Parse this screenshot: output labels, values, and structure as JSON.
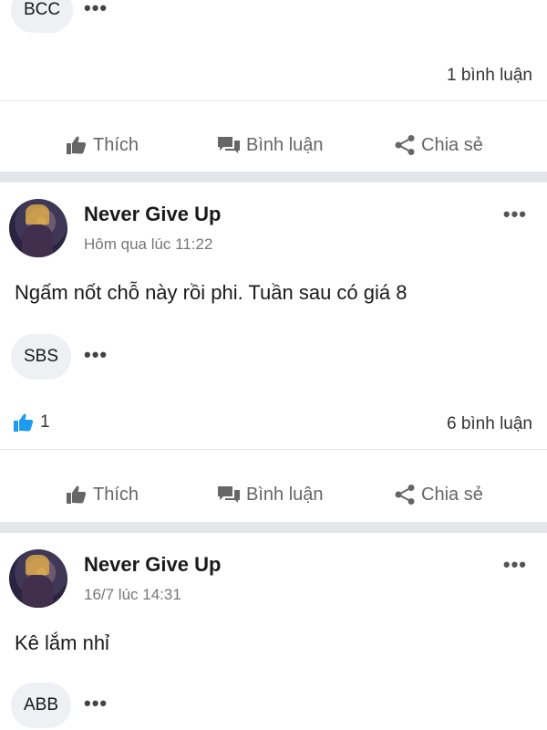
{
  "posts": [
    {
      "tag": "BCC",
      "likes": "",
      "comments": "1 bình luận",
      "actions": {
        "like": "Thích",
        "comment": "Bình luận",
        "share": "Chia sẻ"
      }
    },
    {
      "author": "Never Give Up",
      "time": "Hôm qua lúc 11:22",
      "text": "Ngấm nốt chỗ này rồi phi. Tuần sau có giá 8",
      "tag": "SBS",
      "likes": "1",
      "comments": "6 bình luận",
      "actions": {
        "like": "Thích",
        "comment": "Bình luận",
        "share": "Chia sẻ"
      }
    },
    {
      "author": "Never Give Up",
      "time": "16/7 lúc 14:31",
      "text": "Kê lắm nhỉ",
      "tag": "ABB"
    }
  ],
  "colors": {
    "accent_like": "#1d9bf0",
    "separator": "#e4e6e9",
    "muted": "#666666"
  },
  "icons": {
    "more": "•••",
    "like": "thumbs-up-icon",
    "comment": "comment-icon",
    "share": "share-icon"
  }
}
